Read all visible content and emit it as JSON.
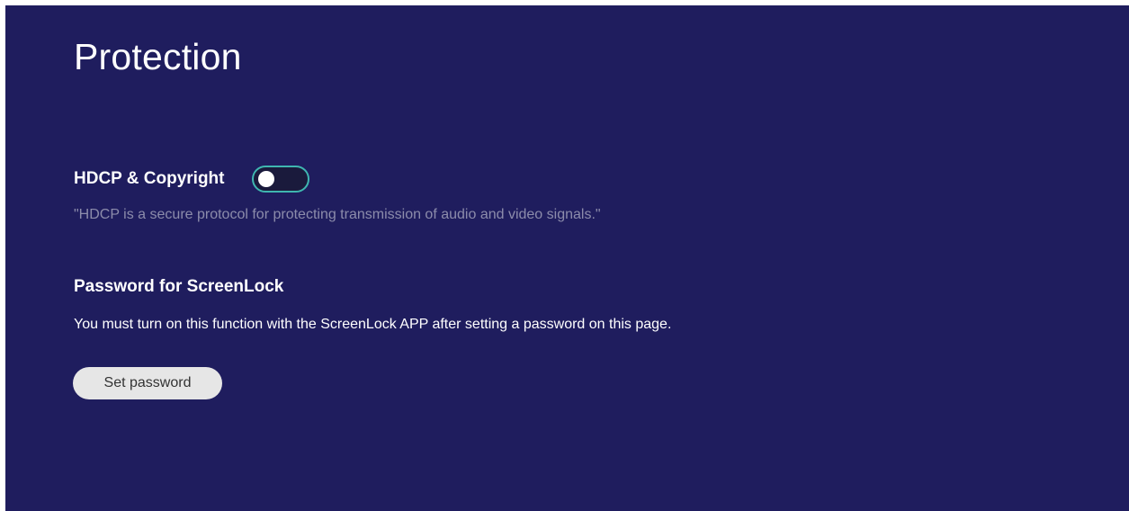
{
  "page": {
    "title": "Protection"
  },
  "hdcp": {
    "label": "HDCP & Copyright",
    "enabled": false,
    "description": "\"HDCP is a secure protocol for protecting transmission of audio and video signals.\""
  },
  "screenlock": {
    "title": "Password for ScreenLock",
    "description": "You must turn on this function with the ScreenLock APP after setting a password on this page.",
    "button_label": "Set password"
  },
  "colors": {
    "background": "#1f1d5e",
    "toggle_border": "#3fb6b0",
    "description_muted": "#8c8cab",
    "button_bg": "#e6e6e6"
  },
  "icons": {
    "toggle": "toggle-switch-off"
  }
}
